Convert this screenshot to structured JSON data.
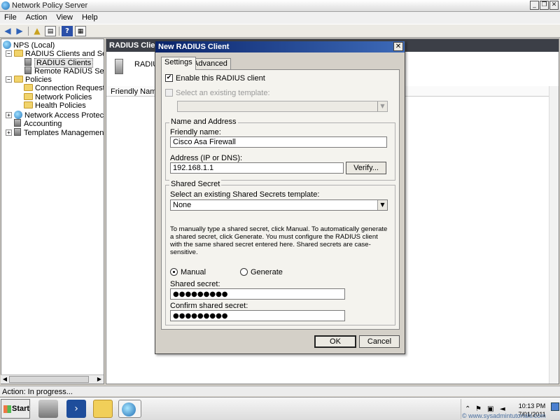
{
  "window": {
    "title": "Network Policy Server"
  },
  "menu": [
    "File",
    "Action",
    "View",
    "Help"
  ],
  "tree": {
    "nodes": [
      {
        "label": "NPS (Local)"
      },
      {
        "label": "RADIUS Clients and Servers"
      },
      {
        "label": "RADIUS Clients"
      },
      {
        "label": "Remote RADIUS Server G"
      },
      {
        "label": "Policies"
      },
      {
        "label": "Connection Request Polici"
      },
      {
        "label": "Network Policies"
      },
      {
        "label": "Health Policies"
      },
      {
        "label": "Network Access Protection"
      },
      {
        "label": "Accounting"
      },
      {
        "label": "Templates Management"
      }
    ]
  },
  "right_pane": {
    "header": "RADIUS Clients",
    "subtitle": "RADIU",
    "column_header": "Friendly Name"
  },
  "status": {
    "text": "Action:  In progress..."
  },
  "dialog": {
    "title": "New RADIUS Client",
    "tabs": [
      "Settings",
      "Advanced"
    ],
    "enable_label": "Enable this RADIUS client",
    "enable_checked": true,
    "select_template_label": "Select an existing template:",
    "select_template_value": "",
    "name_address_group": "Name and Address",
    "friendly_name_label": "Friendly name:",
    "friendly_name_value": "Cisco Asa Firewall",
    "address_label": "Address (IP or DNS):",
    "address_value": "192.168.1.1",
    "verify_label": "Verify...",
    "shared_secret_group": "Shared Secret",
    "shared_template_label": "Select an existing Shared Secrets template:",
    "shared_template_value": "None",
    "instructions": "To manually type a shared secret, click Manual. To automatically generate a shared secret, click Generate. You must configure the RADIUS client with the same shared secret entered here. Shared secrets are case-sensitive.",
    "manual_label": "Manual",
    "generate_label": "Generate",
    "manual_selected": true,
    "shared_secret_label": "Shared secret:",
    "shared_secret_value": "●●●●●●●●●",
    "confirm_secret_label": "Confirm shared secret:",
    "confirm_secret_value": "●●●●●●●●●",
    "ok_label": "OK",
    "cancel_label": "Cancel"
  },
  "taskbar": {
    "start_label": "Start",
    "time": "10:13 PM",
    "date": "7/01/2011"
  },
  "watermark": "© www.sysadmintutorials.com"
}
